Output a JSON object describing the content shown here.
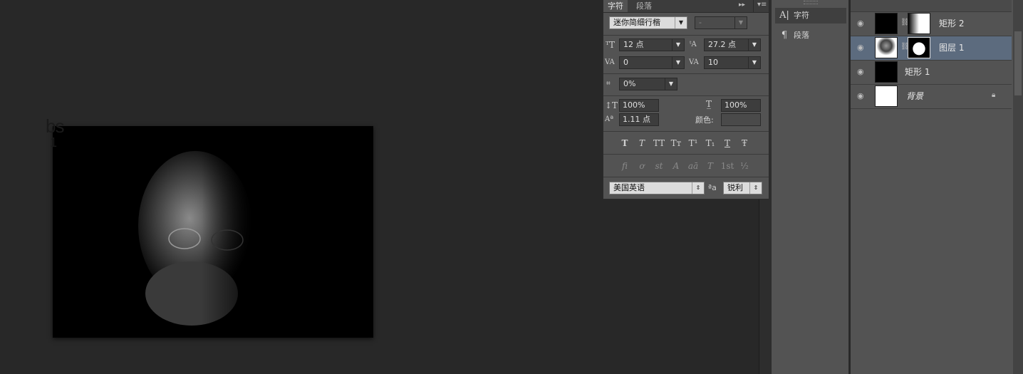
{
  "canvas": {
    "photo_overlay_text": "bs",
    "photo_overlay_sub": "1"
  },
  "char_panel": {
    "tabs": [
      "字符",
      "段落"
    ],
    "font_family": "迷你简细行楷",
    "font_style": "-",
    "font_size": "12 点",
    "leading": "27.2 点",
    "kerning": "0",
    "tracking": "10",
    "tsume": "0%",
    "vertical_scale": "100%",
    "horizontal_scale": "100%",
    "baseline_shift": "1.11 点",
    "color_label": "颜色:",
    "style_buttons": [
      "T",
      "T",
      "TT",
      "Tт",
      "T¹",
      "T₁",
      "T",
      "Ŧ"
    ],
    "opentype_buttons": [
      "ﬁ",
      "ơ",
      "st",
      "A",
      "aā",
      "T",
      "1st",
      "½"
    ],
    "language": "美国英语",
    "aa_icon_label": "ªa",
    "antialias": "锐利"
  },
  "mini_dock": {
    "items": [
      {
        "icon": "A|",
        "label": "字符"
      },
      {
        "icon": "¶",
        "label": "段落"
      }
    ]
  },
  "layers": {
    "items": [
      {
        "name": "矩形 2",
        "visible": true,
        "selected": false,
        "has_mask": true
      },
      {
        "name": "图层 1",
        "visible": true,
        "selected": true,
        "has_mask": true
      },
      {
        "name": "矩形 1",
        "visible": true,
        "selected": false,
        "has_mask": false
      },
      {
        "name": "背景",
        "visible": true,
        "selected": false,
        "locked": true
      }
    ]
  }
}
